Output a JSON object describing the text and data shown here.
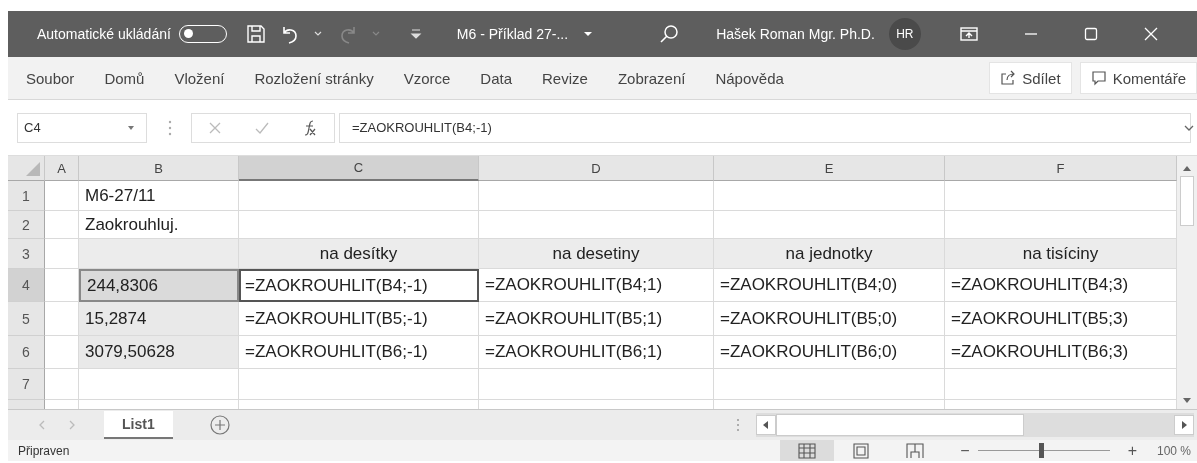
{
  "title_bar": {
    "autosave_label": "Automatické ukládání",
    "autosave_on": false,
    "document_title": "M6 - Příklad 27-...",
    "user_name": "Hašek Roman Mgr. Ph.D.",
    "user_initials": "HR"
  },
  "ribbon": {
    "tabs": [
      {
        "label": "Soubor",
        "selected": false
      },
      {
        "label": "Domů",
        "selected": false
      },
      {
        "label": "Vložení",
        "selected": false
      },
      {
        "label": "Rozložení stránky",
        "selected": false
      },
      {
        "label": "Vzorce",
        "selected": false
      },
      {
        "label": "Data",
        "selected": false
      },
      {
        "label": "Revize",
        "selected": false
      },
      {
        "label": "Zobrazení",
        "selected": false
      },
      {
        "label": "Nápověda",
        "selected": false
      }
    ],
    "share_button": "Sdílet",
    "comments_button": "Komentáře"
  },
  "formula_bar": {
    "name_box": "C4",
    "formula": "=ZAOKROUHLIT(B4;-1)"
  },
  "sheet": {
    "columns": [
      {
        "label": "A",
        "selected": false
      },
      {
        "label": "B",
        "selected": false
      },
      {
        "label": "C",
        "selected": true
      },
      {
        "label": "D",
        "selected": false
      },
      {
        "label": "E",
        "selected": false
      },
      {
        "label": "F",
        "selected": false
      }
    ],
    "rows": [
      {
        "label": "1",
        "selected": false,
        "cells": [
          {
            "kind": "plain",
            "active": false
          },
          {
            "kind": "plain",
            "active": false,
            "text": "M6-27/11"
          },
          {
            "kind": "plain",
            "active": false
          },
          {
            "kind": "plain",
            "active": false
          },
          {
            "kind": "plain",
            "active": false
          },
          {
            "kind": "plain",
            "active": false
          }
        ]
      },
      {
        "label": "2",
        "selected": false,
        "cells": [
          {
            "kind": "plain",
            "active": false
          },
          {
            "kind": "plain",
            "active": false,
            "text": "Zaokrouhluj."
          },
          {
            "kind": "plain",
            "active": false
          },
          {
            "kind": "plain",
            "active": false
          },
          {
            "kind": "plain",
            "active": false
          },
          {
            "kind": "plain",
            "active": false
          }
        ]
      },
      {
        "label": "3",
        "selected": false,
        "cells": [
          {
            "kind": "plain",
            "active": false
          },
          {
            "kind": "heading",
            "active": false
          },
          {
            "kind": "heading",
            "active": false,
            "text": "na desítky"
          },
          {
            "kind": "heading",
            "active": false,
            "text": "na desetiny"
          },
          {
            "kind": "heading",
            "active": false,
            "text": "na jednotky"
          },
          {
            "kind": "heading",
            "active": false,
            "text": "na tisíciny"
          }
        ]
      },
      {
        "label": "4",
        "selected": true,
        "cells": [
          {
            "kind": "plain",
            "active": false
          },
          {
            "kind": "referenced",
            "active": false,
            "text": "244,8306"
          },
          {
            "kind": "plain",
            "active": true,
            "text": "=ZAOKROUHLIT(B4;-1)"
          },
          {
            "kind": "plain",
            "active": false,
            "text": "=ZAOKROUHLIT(B4;1)"
          },
          {
            "kind": "plain",
            "active": false,
            "text": "=ZAOKROUHLIT(B4;0)"
          },
          {
            "kind": "plain",
            "active": false,
            "text": "=ZAOKROUHLIT(B4;3)"
          }
        ]
      },
      {
        "label": "5",
        "selected": false,
        "cells": [
          {
            "kind": "plain",
            "active": false
          },
          {
            "kind": "shaded",
            "active": false,
            "text": "15,2874"
          },
          {
            "kind": "plain",
            "active": false,
            "text": "=ZAOKROUHLIT(B5;-1)"
          },
          {
            "kind": "plain",
            "active": false,
            "text": "=ZAOKROUHLIT(B5;1)"
          },
          {
            "kind": "plain",
            "active": false,
            "text": "=ZAOKROUHLIT(B5;0)"
          },
          {
            "kind": "plain",
            "active": false,
            "text": "=ZAOKROUHLIT(B5;3)"
          }
        ]
      },
      {
        "label": "6",
        "selected": false,
        "cells": [
          {
            "kind": "plain",
            "active": false
          },
          {
            "kind": "shaded",
            "active": false,
            "text": "3079,50628"
          },
          {
            "kind": "plain",
            "active": false,
            "text": "=ZAOKROUHLIT(B6;-1)"
          },
          {
            "kind": "plain",
            "active": false,
            "text": "=ZAOKROUHLIT(B6;1)"
          },
          {
            "kind": "plain",
            "active": false,
            "text": "=ZAOKROUHLIT(B6;0)"
          },
          {
            "kind": "plain",
            "active": false,
            "text": "=ZAOKROUHLIT(B6;3)"
          }
        ]
      },
      {
        "label": "7",
        "selected": false,
        "cells": [
          {
            "kind": "plain",
            "active": false
          },
          {
            "kind": "plain",
            "active": false
          },
          {
            "kind": "plain",
            "active": false
          },
          {
            "kind": "plain",
            "active": false
          },
          {
            "kind": "plain",
            "active": false
          },
          {
            "kind": "plain",
            "active": false
          }
        ]
      }
    ]
  },
  "sheet_tabs": [
    {
      "label": "List1",
      "selected": true
    }
  ],
  "status_bar": {
    "status": "Připraven",
    "views": [
      {
        "kind": "normal",
        "selected": true
      },
      {
        "kind": "page_layout",
        "selected": false
      },
      {
        "kind": "page_break",
        "selected": false
      }
    ],
    "zoom_out": "−",
    "zoom_in": "+",
    "zoom": {
      "level": 0.48
    },
    "zoom_text": "100 %"
  }
}
